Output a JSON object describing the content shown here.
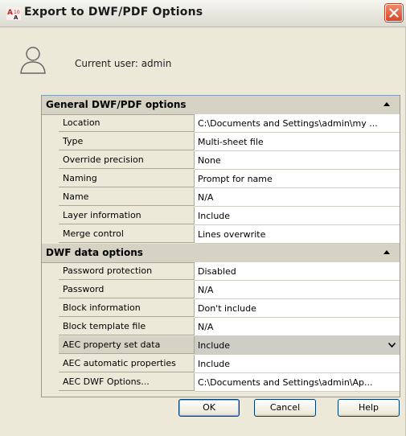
{
  "window": {
    "title": "Export to DWF/PDF Options"
  },
  "user": {
    "text": "Current user: admin"
  },
  "sections": [
    {
      "title": "General DWF/PDF options",
      "rows": [
        {
          "label": "Location",
          "value": "C:\\Documents and Settings\\admin\\my ..."
        },
        {
          "label": "Type",
          "value": "Multi-sheet file"
        },
        {
          "label": "Override precision",
          "value": "None"
        },
        {
          "label": "Naming",
          "value": "Prompt for name"
        },
        {
          "label": "Name",
          "value": "N/A"
        },
        {
          "label": "Layer information",
          "value": "Include"
        },
        {
          "label": "Merge control",
          "value": "Lines overwrite"
        }
      ]
    },
    {
      "title": "DWF data options",
      "rows": [
        {
          "label": "Password protection",
          "value": "Disabled"
        },
        {
          "label": "Password",
          "value": "N/A"
        },
        {
          "label": "Block information",
          "value": "Don't include"
        },
        {
          "label": "Block template file",
          "value": "N/A"
        },
        {
          "label": "AEC property set data",
          "value": "Include"
        },
        {
          "label": "AEC automatic properties",
          "value": "Include"
        },
        {
          "label": "AEC DWF Options...",
          "value": "C:\\Documents and Settings\\admin\\Ap..."
        }
      ]
    }
  ],
  "buttons": {
    "ok": "OK",
    "cancel": "Cancel",
    "help": "Help"
  },
  "icons": {
    "app": "autocad-app-icon",
    "close": "close-icon",
    "user": "user-icon",
    "collapse": "collapse-up-icon",
    "dropdown": "dropdown-arrow-icon"
  },
  "colors": {
    "close_button": "#d9462a",
    "panel_border": "#7f9db9",
    "header_bg": "#d6d3c4"
  }
}
